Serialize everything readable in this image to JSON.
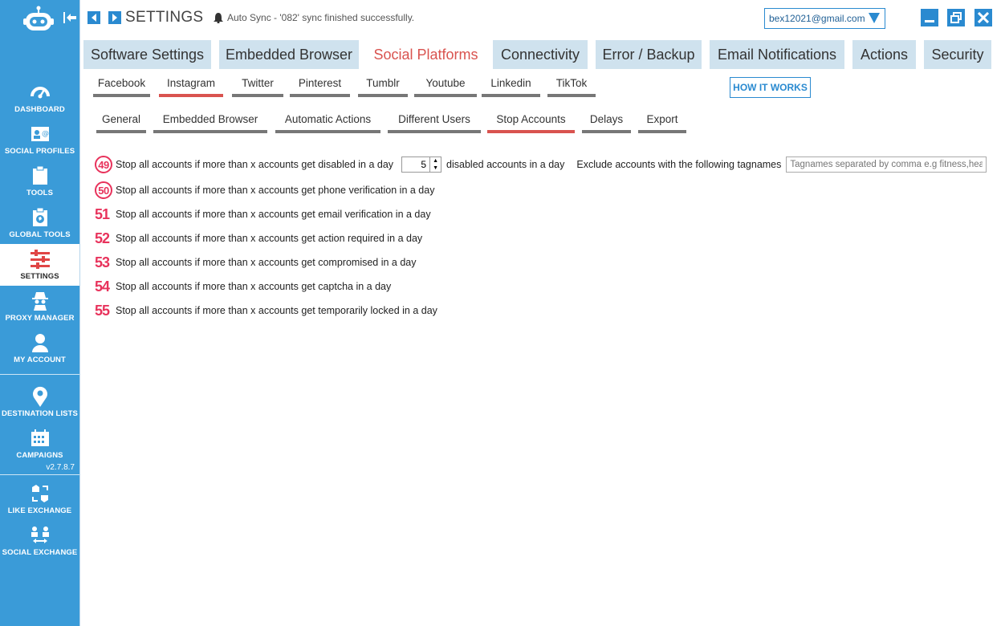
{
  "sidebar": {
    "logo_icon": "robot-icon",
    "collapse_icon": "collapse-arrow-icon",
    "items": [
      {
        "label": "DASHBOARD",
        "icon": "speedometer-icon"
      },
      {
        "label": "SOCIAL PROFILES",
        "icon": "profile-card-icon"
      },
      {
        "label": "TOOLS",
        "icon": "clipboard-icon"
      },
      {
        "label": "GLOBAL TOOLS",
        "icon": "globe-clipboard-icon"
      },
      {
        "label": "SETTINGS",
        "icon": "sliders-icon",
        "active": true
      },
      {
        "label": "PROXY MANAGER",
        "icon": "spy-icon"
      },
      {
        "label": "MY ACCOUNT",
        "icon": "user-icon"
      }
    ],
    "items2": [
      {
        "label": "DESTINATION LISTS",
        "icon": "map-pin-icon"
      },
      {
        "label": "CAMPAIGNS",
        "icon": "calendar-icon"
      }
    ],
    "version": "v2.7.8.7",
    "items3": [
      {
        "label": "LIKE EXCHANGE",
        "icon": "hand-exchange-icon"
      },
      {
        "label": "SOCIAL EXCHANGE",
        "icon": "users-exchange-icon"
      }
    ]
  },
  "header": {
    "title": "SETTINGS",
    "sync_message": "Auto Sync - '082' sync finished successfully.",
    "account": "bex12021@gmail.com",
    "accent_color": "#2a8ad0"
  },
  "top_tabs": [
    "Software Settings",
    "Embedded Browser",
    "Social Platforms",
    "Connectivity",
    "Error / Backup",
    "Email Notifications",
    "Actions",
    "Security"
  ],
  "platform_tabs": [
    "Facebook",
    "Instagram",
    "Twitter",
    "Pinterest",
    "Tumblr",
    "Youtube",
    "Linkedin",
    "TikTok"
  ],
  "how_it_works": "HOW IT WORKS",
  "section_tabs": [
    "General",
    "Embedded Browser",
    "Automatic Actions",
    "Different Users",
    "Stop Accounts",
    "Delays",
    "Export"
  ],
  "settings": {
    "rows": [
      {
        "num": "49",
        "text": "Stop all accounts if more than x accounts get disabled in a day"
      },
      {
        "num": "50",
        "text": "Stop all accounts if more than x accounts get phone verification in a day"
      },
      {
        "num": "51",
        "text": "Stop all accounts if more than x accounts get email verification in a day"
      },
      {
        "num": "52",
        "text": "Stop all accounts if more than x accounts get action required in a day"
      },
      {
        "num": "53",
        "text": "Stop all accounts if more than x accounts get compromised in a day"
      },
      {
        "num": "54",
        "text": "Stop all accounts if more than x accounts get captcha in a day"
      },
      {
        "num": "55",
        "text": "Stop all accounts if more than x accounts get temporarily locked in a day"
      }
    ],
    "disabled_count": "5",
    "disabled_suffix": "disabled accounts in a day",
    "exclude_label": "Exclude accounts with the following tagnames",
    "tag_placeholder": "Tagnames separated by comma e.g fitness,health"
  }
}
